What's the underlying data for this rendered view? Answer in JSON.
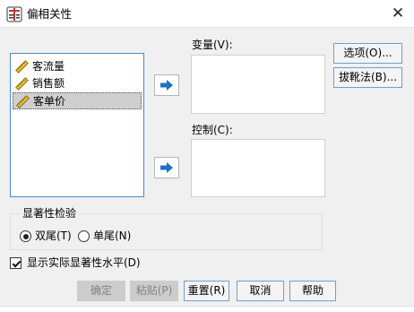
{
  "window": {
    "title": "偏相关性",
    "close_glyph": "✕"
  },
  "variables": {
    "items": [
      {
        "label": "客流量",
        "selected": false,
        "icon": "ruler-scale-icon"
      },
      {
        "label": "销售额",
        "selected": false,
        "icon": "ruler-scale-icon"
      },
      {
        "label": "客单价",
        "selected": true,
        "icon": "ruler-scale-icon"
      }
    ]
  },
  "target_box": {
    "label": "变量(V):"
  },
  "control_box": {
    "label": "控制(C):"
  },
  "side_buttons": {
    "options": "选项(O)...",
    "bootstrap": "拔靴法(B)..."
  },
  "significance": {
    "legend": "显著性检验",
    "two_tailed": "双尾(T)",
    "one_tailed": "单尾(N)",
    "selected": "two_tailed"
  },
  "flag": {
    "label": "显示实际显著性水平(D)",
    "checked": true
  },
  "footer": {
    "ok": "确定",
    "paste": "粘贴(P)",
    "reset": "重置(R)",
    "cancel": "取消",
    "help": "帮助"
  },
  "colors": {
    "accent": "#1f6fc6",
    "list_border": "#4b89c8",
    "selection": "#cfcfcf"
  }
}
